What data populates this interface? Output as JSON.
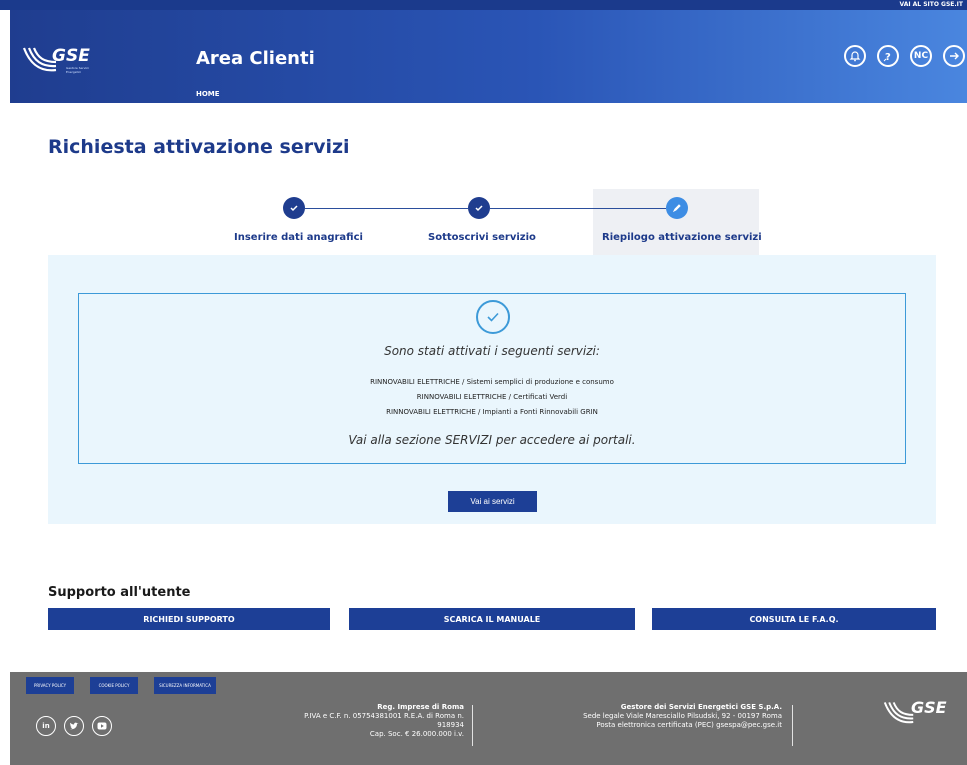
{
  "topbar": {
    "site_link": "VAI AL SITO GSE.IT"
  },
  "header": {
    "logo_text": "GSE",
    "logo_subtext": "Gestore Servizi Energetici",
    "app_title": "Area Clienti",
    "breadcrumb_home": "HOME",
    "icons": [
      "notification-icon",
      "help-icon",
      "nc-icon",
      "logout-icon"
    ],
    "nc_label": "NC"
  },
  "page": {
    "title": "Richiesta attivazione servizi"
  },
  "stepper": {
    "steps": [
      {
        "label": "Inserire dati anagrafici",
        "state": "done"
      },
      {
        "label": "Sottoscrivi servizio",
        "state": "done"
      },
      {
        "label": "Riepilogo attivazione servizi",
        "state": "active"
      }
    ]
  },
  "summary": {
    "headline": "Sono stati attivati i seguenti servizi:",
    "services": [
      "RINNOVABILI ELETTRICHE / Sistemi semplici di produzione e consumo",
      "RINNOVABILI ELETTRICHE / Certificati Verdi",
      "RINNOVABILI ELETTRICHE / Impianti a Fonti Rinnovabili GRIN"
    ],
    "footer_text": "Vai alla sezione SERVIZI per accedere ai portali.",
    "button_label": "Vai ai servizi"
  },
  "support": {
    "title": "Supporto all'utente",
    "buttons": [
      "RICHIEDI SUPPORTO",
      "SCARICA IL MANUALE",
      "CONSULTA LE F.A.Q."
    ]
  },
  "footer": {
    "policy_links": [
      "PRIVACY POLICY",
      "COOKIE POLICY",
      "SICUREZZA INFORMATICA"
    ],
    "social": [
      "linkedin-icon",
      "twitter-icon",
      "youtube-icon"
    ],
    "registry": {
      "line1": "Reg. Imprese di Roma",
      "line2": "P.IVA e C.F. n. 05754381001 R.E.A. di Roma n.",
      "line3": "918934",
      "line4": "Cap. Soc. € 26.000.000 i.v."
    },
    "company": {
      "line1": "Gestore dei Servizi Energetici GSE S.p.A.",
      "line2": "Sede legale Viale Maresciallo Pilsudski, 92 - 00197 Roma",
      "line3": "Posta elettronica certificata (PEC) gsespa@pec.gse.it"
    },
    "logo_text": "GSE"
  },
  "colors": {
    "primary": "#1d3f96",
    "header_start": "#1f3d8f",
    "header_end": "#4a86df",
    "accent": "#3d9ad8",
    "panel_bg": "#eaf6fd",
    "footer_bg": "#6f6f6f"
  }
}
